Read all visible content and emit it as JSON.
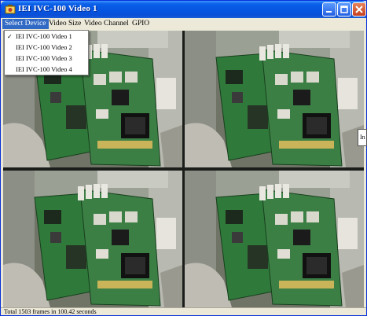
{
  "window": {
    "title": "IEI IVC-100 Video 1",
    "colors": {
      "titlebar": "#0a5fe8",
      "menu_highlight": "#316ac5",
      "close": "#c4401f"
    }
  },
  "menu": {
    "items": [
      "Select Device",
      "Video Size",
      "Video Channel",
      "GPIO"
    ],
    "active": "Select Device"
  },
  "device_menu": {
    "items": [
      {
        "label": "IEI IVC-100 Video 1",
        "checked": true
      },
      {
        "label": "IEI IVC-100 Video 2",
        "checked": false
      },
      {
        "label": "IEI IVC-100 Video 3",
        "checked": false
      },
      {
        "label": "IEI IVC-100 Video 4",
        "checked": false
      }
    ],
    "check_mark": "✓"
  },
  "video": {
    "tiles": 4,
    "subject": "capture board on bench"
  },
  "side_tooltip": "In",
  "status": {
    "text": "Total 1503 frames in 100.42 seconds"
  }
}
